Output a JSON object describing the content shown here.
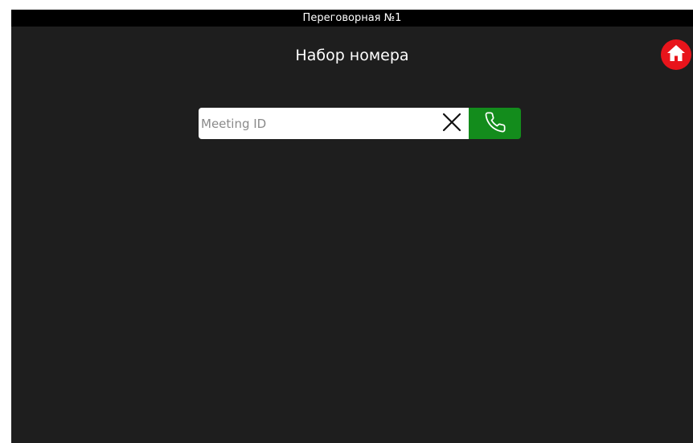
{
  "titlebar": {
    "title": "Переговорная №1"
  },
  "page": {
    "title": "Набор номера"
  },
  "home_button": {
    "icon": "home-icon",
    "color": "#e8141b"
  },
  "dial": {
    "placeholder": "Meeting ID",
    "value": "",
    "clear_icon": "close-icon",
    "call_icon": "phone-icon",
    "call_color": "#138c1c"
  }
}
